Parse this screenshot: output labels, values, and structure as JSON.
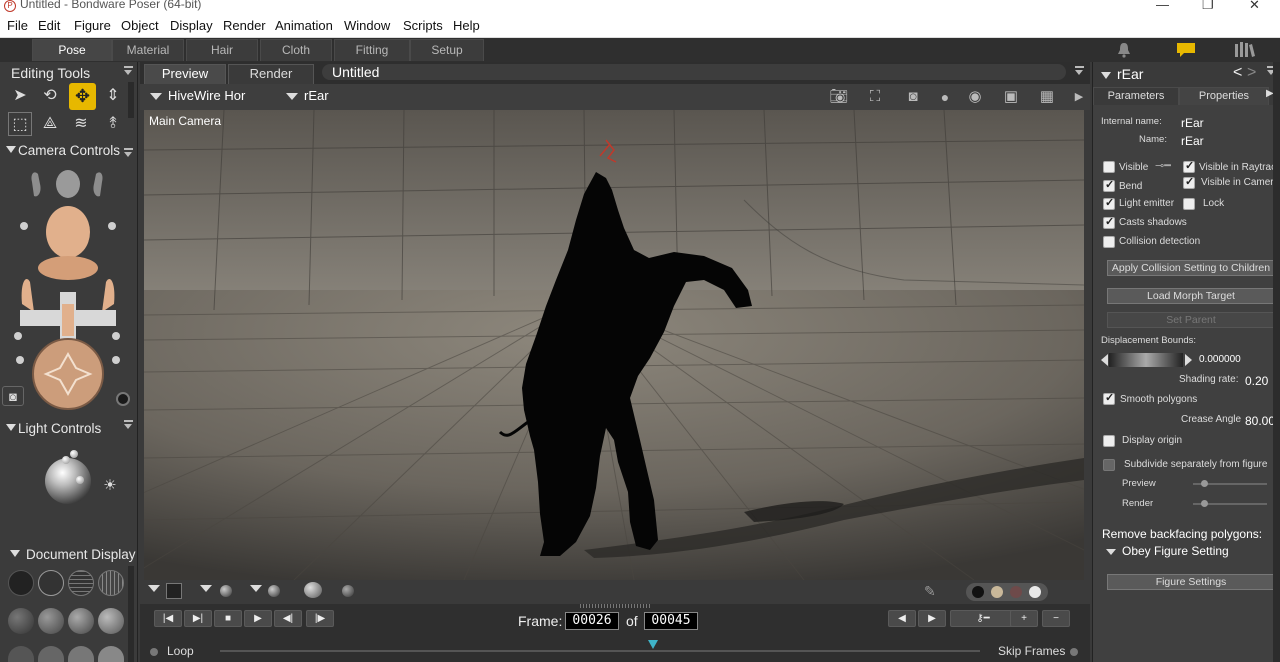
{
  "window": {
    "title": "Untitled - Bondware Poser (64-bit)"
  },
  "menu": [
    "File",
    "Edit",
    "Figure",
    "Object",
    "Display",
    "Render",
    "Animation",
    "Window",
    "Scripts",
    "Help"
  ],
  "rooms": {
    "tabs": [
      "Pose",
      "Material",
      "Hair",
      "Cloth",
      "Fitting",
      "Setup"
    ],
    "active": "Pose"
  },
  "left_panel": {
    "editing_tools": "Editing Tools",
    "camera_controls": "Camera Controls",
    "light_controls": "Light Controls",
    "document_display": "Document  Display"
  },
  "viewport": {
    "tabs": [
      "Preview",
      "Render"
    ],
    "doc_title": "Untitled",
    "figure_select": "HiveWire Hor",
    "actor_select": "rEar",
    "camera_label": "Main Camera"
  },
  "timeline": {
    "frame_label": "Frame:",
    "current_frame": "00026",
    "of_label": "of",
    "total_frames": "00045",
    "loop_label": "Loop",
    "skip_frames_label": "Skip Frames",
    "playhead_fraction": 0.57
  },
  "right_panel": {
    "title": "rEar",
    "tabs": [
      "Parameters",
      "Properties"
    ],
    "active_tab": "Properties",
    "internal_name_label": "Internal name:",
    "internal_name": "rEar",
    "name_label": "Name:",
    "name": "rEar",
    "checks": {
      "visible": {
        "label": "Visible",
        "checked": false
      },
      "visible_in_raytracing": {
        "label": "Visible in Raytraci",
        "checked": true
      },
      "bend": {
        "label": "Bend",
        "checked": true
      },
      "visible_in_camera": {
        "label": "Visible in Camera",
        "checked": true
      },
      "light_emitter": {
        "label": "Light emitter",
        "checked": true
      },
      "lock": {
        "label": "Lock",
        "checked": false
      },
      "casts_shadows": {
        "label": "Casts shadows",
        "checked": true
      },
      "collision_detection": {
        "label": "Collision detection",
        "checked": false
      },
      "smooth_polygons": {
        "label": "Smooth polygons",
        "checked": true
      },
      "display_origin": {
        "label": "Display origin",
        "checked": false
      },
      "subdivide_separately": {
        "label": "Subdivide separately from figure",
        "checked": false
      }
    },
    "apply_collision_button": "Apply Collision Setting to Children",
    "load_morph_button": "Load Morph Target",
    "set_parent_button": "Set Parent",
    "displacement_bounds_label": "Displacement Bounds:",
    "displacement_bounds_value": "0.000000",
    "shading_rate_label": "Shading rate:",
    "shading_rate_value": "0.20",
    "crease_angle_label": "Crease Angle",
    "crease_angle_value": "80.00",
    "preview_label": "Preview",
    "render_label": "Render",
    "remove_backfacing_label": "Remove backfacing polygons:",
    "obey_figure_setting": "Obey Figure Setting",
    "figure_settings_button": "Figure Settings"
  },
  "colors": {
    "accent_selected_tool": "#e7b800",
    "notification_icon": "#e7b800"
  }
}
